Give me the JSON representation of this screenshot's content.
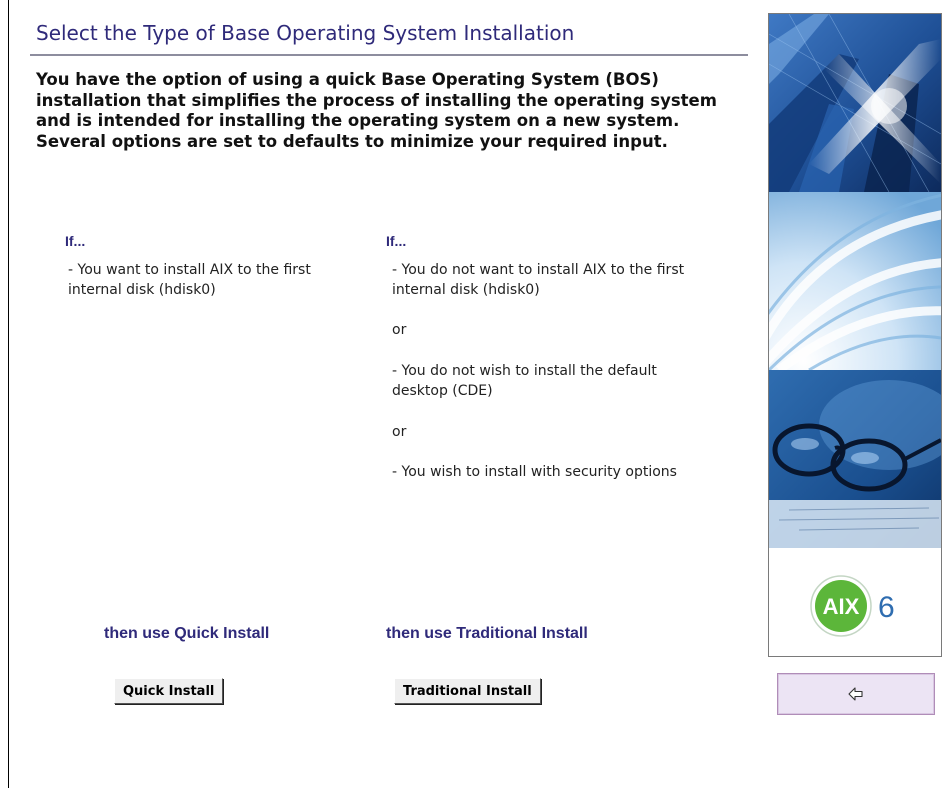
{
  "page": {
    "title": "Select the Type of Base Operating System Installation",
    "intro": "You have the option of using a quick Base Operating System (BOS) installation that simplifies the process of installing the operating system and is intended for installing the operating system on a new system. Several options are set to defaults to minimize your required input."
  },
  "left_column": {
    "if_label": "If...",
    "conditions": [
      "- You want to install AIX to the first internal disk (hdisk0)"
    ],
    "then_label": "then use Quick Install",
    "button_label": "Quick Install"
  },
  "right_column": {
    "if_label": "If...",
    "conditions": [
      "- You do not want to install AIX to the first internal disk (hdisk0)",
      "or",
      "- You do not wish to install the default desktop (CDE)",
      "or",
      "- You wish to install with security options"
    ],
    "then_label": "then use Traditional Install",
    "button_label": "Traditional Install"
  },
  "side_panel": {
    "logo_text": "AIX",
    "logo_version": "6",
    "back_icon": "back-arrow-icon"
  },
  "colors": {
    "heading": "#2f2a7a",
    "logo_green": "#5cb63a",
    "back_button_bg": "#ece4f4"
  }
}
